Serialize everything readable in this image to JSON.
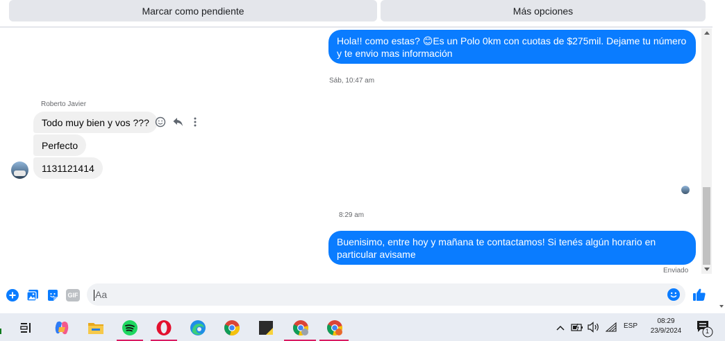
{
  "toolbar": {
    "mark_pending_label": "Marcar como pendiente",
    "more_options_label": "Más opciones"
  },
  "messages": {
    "outgoing_1": "Hola!! como estas? 😊Es un Polo 0km con cuotas de $275mil. Dejame tu número y te envio mas información",
    "timestamp_1": "Sáb, 10:47 am",
    "sender_name": "Roberto Javier",
    "incoming_1": "Todo muy bien y vos ???",
    "incoming_2": "Perfecto",
    "incoming_3": "1131121414",
    "timestamp_2": "8:29 am",
    "outgoing_2": "Buenisimo, entre hoy y mañana te contactamos! Si tenés algún horario en particular avisame",
    "status": "Enviado"
  },
  "composer": {
    "placeholder": "Aa",
    "gif_label": "GIF"
  },
  "taskbar": {
    "language": "ESP",
    "time": "08:29",
    "date": "23/9/2024",
    "notification_count": "1"
  },
  "colors": {
    "accent": "#0a7cff",
    "bubble_in": "#f0f0f0",
    "taskbar_bg": "#e8ecf3"
  }
}
